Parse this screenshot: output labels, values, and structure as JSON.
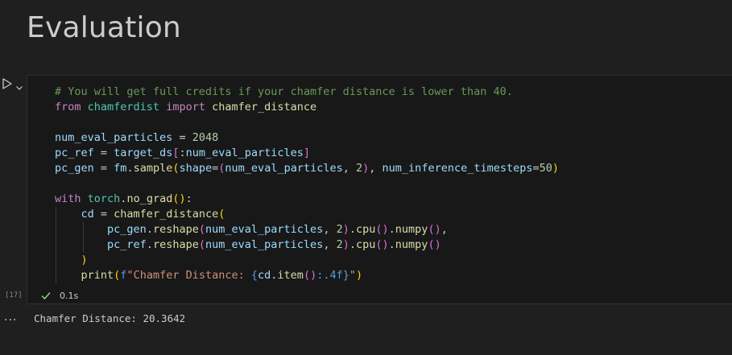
{
  "heading": "Evaluation",
  "cell": {
    "execution_count": "[17]",
    "status_icon": "check-icon",
    "duration": "0.1s",
    "code_lines": [
      [
        {
          "t": "# You will get full credits if your chamfer distance is lower than 40.",
          "c": "#6a9955"
        }
      ],
      [
        {
          "t": "from",
          "c": "#c586c0"
        },
        {
          "t": " ",
          "c": "#cccccc"
        },
        {
          "t": "chamferdist",
          "c": "#4ec9b0"
        },
        {
          "t": " ",
          "c": "#cccccc"
        },
        {
          "t": "import",
          "c": "#c586c0"
        },
        {
          "t": " ",
          "c": "#cccccc"
        },
        {
          "t": "chamfer_distance",
          "c": "#dcdcaa"
        }
      ],
      [
        {
          "t": "",
          "c": "#cccccc"
        }
      ],
      [
        {
          "t": "num_eval_particles",
          "c": "#9cdcfe"
        },
        {
          "t": " = ",
          "c": "#cccccc"
        },
        {
          "t": "2048",
          "c": "#b5cea8"
        }
      ],
      [
        {
          "t": "pc_ref",
          "c": "#9cdcfe"
        },
        {
          "t": " = ",
          "c": "#cccccc"
        },
        {
          "t": "target_ds",
          "c": "#9cdcfe"
        },
        {
          "t": "[",
          "c": "#da70d6"
        },
        {
          "t": ":",
          "c": "#cccccc"
        },
        {
          "t": "num_eval_particles",
          "c": "#9cdcfe"
        },
        {
          "t": "]",
          "c": "#da70d6"
        }
      ],
      [
        {
          "t": "pc_gen",
          "c": "#9cdcfe"
        },
        {
          "t": " = ",
          "c": "#cccccc"
        },
        {
          "t": "fm",
          "c": "#9cdcfe"
        },
        {
          "t": ".",
          "c": "#cccccc"
        },
        {
          "t": "sample",
          "c": "#dcdcaa"
        },
        {
          "t": "(",
          "c": "#ffd700"
        },
        {
          "t": "shape",
          "c": "#9cdcfe"
        },
        {
          "t": "=",
          "c": "#cccccc"
        },
        {
          "t": "(",
          "c": "#da70d6"
        },
        {
          "t": "num_eval_particles",
          "c": "#9cdcfe"
        },
        {
          "t": ", ",
          "c": "#cccccc"
        },
        {
          "t": "2",
          "c": "#b5cea8"
        },
        {
          "t": ")",
          "c": "#da70d6"
        },
        {
          "t": ", ",
          "c": "#cccccc"
        },
        {
          "t": "num_inference_timesteps",
          "c": "#9cdcfe"
        },
        {
          "t": "=",
          "c": "#cccccc"
        },
        {
          "t": "50",
          "c": "#b5cea8"
        },
        {
          "t": ")",
          "c": "#ffd700"
        }
      ],
      [
        {
          "t": "",
          "c": "#cccccc"
        }
      ],
      [
        {
          "t": "with",
          "c": "#c586c0"
        },
        {
          "t": " ",
          "c": "#cccccc"
        },
        {
          "t": "torch",
          "c": "#4ec9b0"
        },
        {
          "t": ".",
          "c": "#cccccc"
        },
        {
          "t": "no_grad",
          "c": "#dcdcaa"
        },
        {
          "t": "()",
          "c": "#ffd700"
        },
        {
          "t": ":",
          "c": "#cccccc"
        }
      ],
      [
        {
          "t": "    ",
          "c": "#cccccc"
        },
        {
          "t": "cd",
          "c": "#9cdcfe"
        },
        {
          "t": " = ",
          "c": "#cccccc"
        },
        {
          "t": "chamfer_distance",
          "c": "#dcdcaa"
        },
        {
          "t": "(",
          "c": "#ffd700"
        }
      ],
      [
        {
          "t": "        ",
          "c": "#cccccc"
        },
        {
          "t": "pc_gen",
          "c": "#9cdcfe"
        },
        {
          "t": ".",
          "c": "#cccccc"
        },
        {
          "t": "reshape",
          "c": "#dcdcaa"
        },
        {
          "t": "(",
          "c": "#da70d6"
        },
        {
          "t": "num_eval_particles",
          "c": "#9cdcfe"
        },
        {
          "t": ", ",
          "c": "#cccccc"
        },
        {
          "t": "2",
          "c": "#b5cea8"
        },
        {
          "t": ")",
          "c": "#da70d6"
        },
        {
          "t": ".",
          "c": "#cccccc"
        },
        {
          "t": "cpu",
          "c": "#dcdcaa"
        },
        {
          "t": "()",
          "c": "#da70d6"
        },
        {
          "t": ".",
          "c": "#cccccc"
        },
        {
          "t": "numpy",
          "c": "#dcdcaa"
        },
        {
          "t": "()",
          "c": "#da70d6"
        },
        {
          "t": ",",
          "c": "#cccccc"
        }
      ],
      [
        {
          "t": "        ",
          "c": "#cccccc"
        },
        {
          "t": "pc_ref",
          "c": "#9cdcfe"
        },
        {
          "t": ".",
          "c": "#cccccc"
        },
        {
          "t": "reshape",
          "c": "#dcdcaa"
        },
        {
          "t": "(",
          "c": "#da70d6"
        },
        {
          "t": "num_eval_particles",
          "c": "#9cdcfe"
        },
        {
          "t": ", ",
          "c": "#cccccc"
        },
        {
          "t": "2",
          "c": "#b5cea8"
        },
        {
          "t": ")",
          "c": "#da70d6"
        },
        {
          "t": ".",
          "c": "#cccccc"
        },
        {
          "t": "cpu",
          "c": "#dcdcaa"
        },
        {
          "t": "()",
          "c": "#da70d6"
        },
        {
          "t": ".",
          "c": "#cccccc"
        },
        {
          "t": "numpy",
          "c": "#dcdcaa"
        },
        {
          "t": "()",
          "c": "#da70d6"
        }
      ],
      [
        {
          "t": "    ",
          "c": "#cccccc"
        },
        {
          "t": ")",
          "c": "#ffd700"
        }
      ],
      [
        {
          "t": "    ",
          "c": "#cccccc"
        },
        {
          "t": "print",
          "c": "#dcdcaa"
        },
        {
          "t": "(",
          "c": "#ffd700"
        },
        {
          "t": "f",
          "c": "#569cd6"
        },
        {
          "t": "\"Chamfer Distance: ",
          "c": "#ce9178"
        },
        {
          "t": "{",
          "c": "#569cd6"
        },
        {
          "t": "cd",
          "c": "#9cdcfe"
        },
        {
          "t": ".",
          "c": "#cccccc"
        },
        {
          "t": "item",
          "c": "#dcdcaa"
        },
        {
          "t": "()",
          "c": "#da70d6"
        },
        {
          "t": ":.4f",
          "c": "#569cd6"
        },
        {
          "t": "}",
          "c": "#569cd6"
        },
        {
          "t": "\"",
          "c": "#ce9178"
        },
        {
          "t": ")",
          "c": "#ffd700"
        }
      ]
    ]
  },
  "output": {
    "text": "Chamfer Distance: 20.3642",
    "more_label": "..."
  },
  "icons": {
    "run": "run-cell-icon",
    "chevron": "chevron-down-icon",
    "check": "check-icon"
  },
  "colors": {
    "background": "#1f1f1f",
    "cell_background": "#181818",
    "success": "#89d185"
  }
}
